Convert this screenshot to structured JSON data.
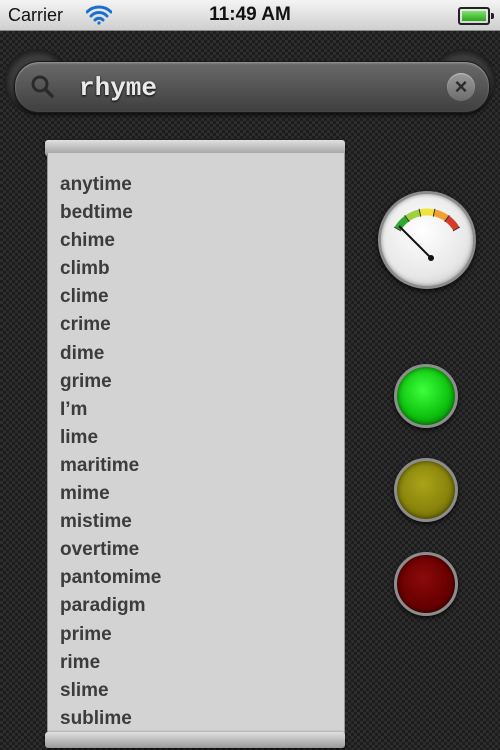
{
  "status_bar": {
    "carrier": "Carrier",
    "time": "11:49 AM",
    "icons": [
      "wifi-icon",
      "battery-icon"
    ]
  },
  "search": {
    "value": "rhyme",
    "icon": "search-icon",
    "clear_label": "×"
  },
  "results": [
    "anytime",
    "bedtime",
    "chime",
    "climb",
    "clime",
    "crime",
    "dime",
    "grime",
    "I’m",
    "lime",
    "maritime",
    "mime",
    "mistime",
    "overtime",
    "pantomime",
    "paradigm",
    "prime",
    "rime",
    "slime",
    "sublime"
  ],
  "gauge": {
    "icon": "meter-gauge-icon",
    "colors": [
      "#2fa82f",
      "#9fd23a",
      "#f2e23c",
      "#f0a030",
      "#d83a2a"
    ]
  },
  "lights": [
    {
      "name": "green-light",
      "color": "#1ee61e",
      "state": "on"
    },
    {
      "name": "yellow-light",
      "color": "#9a9410",
      "state": "dim"
    },
    {
      "name": "red-light",
      "color": "#7a0000",
      "state": "dim"
    }
  ]
}
